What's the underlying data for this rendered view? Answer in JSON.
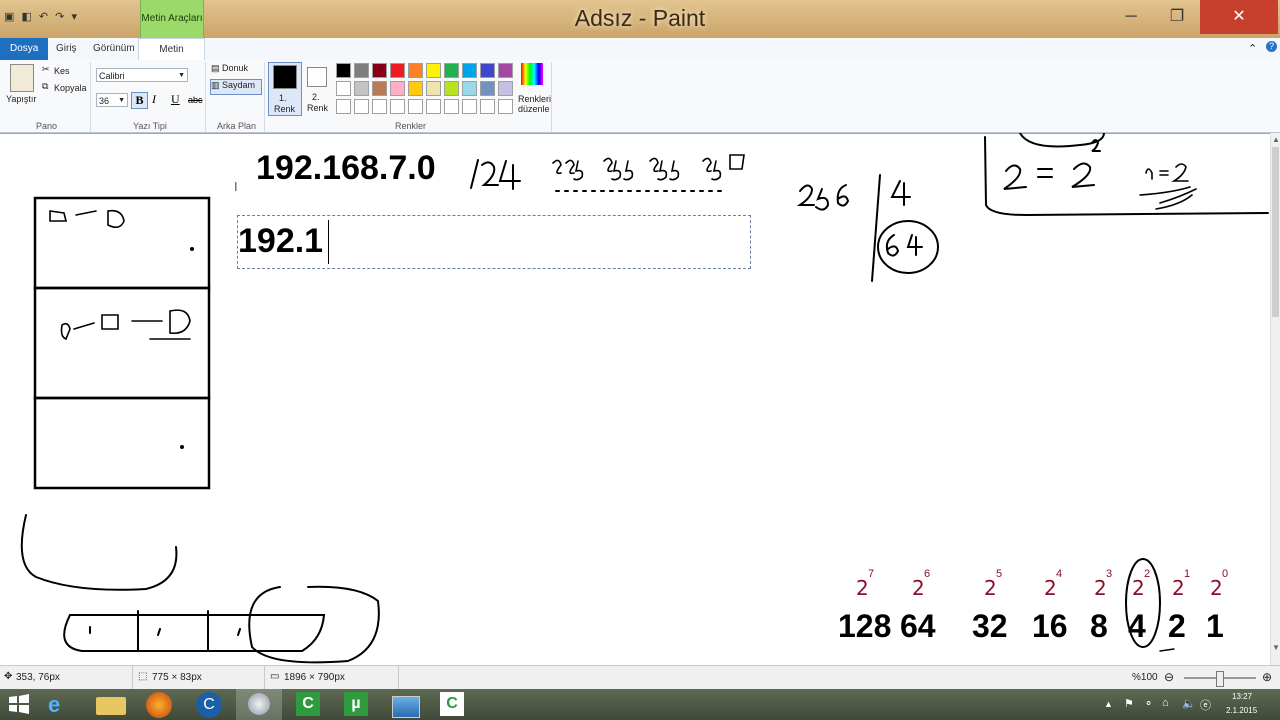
{
  "window": {
    "title": "Adsız - Paint",
    "context_tab": "Metin Araçları",
    "minimize": "─",
    "maximize": "❐",
    "close": "✕"
  },
  "tabs": [
    "Dosya",
    "Giriş",
    "Görünüm",
    "Metin"
  ],
  "ribbon": {
    "clipboard": {
      "paste": "Yapıştır",
      "cut": "Kes",
      "copy": "Kopyala",
      "label": "Pano"
    },
    "font": {
      "family": "Calibri",
      "size": "36",
      "bold": "B",
      "italic": "I",
      "underline": "U",
      "strike": "abc",
      "label": "Yazı Tipi"
    },
    "background": {
      "opaque": "Donuk",
      "transparent": "Saydam",
      "label": "Arka Plan"
    },
    "color1": {
      "label": "1.\nRenk",
      "l1": "1.",
      "l2": "Renk",
      "value": "#000000"
    },
    "color2": {
      "l1": "2.",
      "l2": "Renk",
      "value": "#ffffff"
    },
    "colors_label": "Renkler",
    "edit_colors": {
      "l1": "Renkleri",
      "l2": "düzenle"
    },
    "palette_row1": [
      "#000000",
      "#7f7f7f",
      "#880015",
      "#ed1c24",
      "#ff7f27",
      "#fff200",
      "#22b14c",
      "#00a2e8",
      "#3f48cc",
      "#a349a4"
    ],
    "palette_row2": [
      "#ffffff",
      "#c3c3c3",
      "#b97a57",
      "#ffaec9",
      "#ffc90e",
      "#efe4b0",
      "#b5e61d",
      "#99d9ea",
      "#7092be",
      "#c8bfe7"
    ]
  },
  "canvas": {
    "ip_heading": "192.168.7.0",
    "cidr": "/24",
    "mask": "255.255.255.0",
    "text_box_value": "192.1",
    "division": "256 | 4",
    "result": "64",
    "powers_exponents": [
      "7",
      "6",
      "5",
      "4",
      "3",
      "2",
      "1",
      "0"
    ],
    "powers_values": [
      "128",
      "64",
      "32",
      "16",
      "8",
      "4",
      "2",
      "1"
    ],
    "n_eq": "n=2"
  },
  "status": {
    "cursor_pos": "353, 76px",
    "selection_size": "775 × 83px",
    "image_size": "1896 × 790px",
    "zoom": "%100"
  },
  "taskbar": {
    "clock_time": "13:27",
    "clock_date": "2.1.2015"
  }
}
